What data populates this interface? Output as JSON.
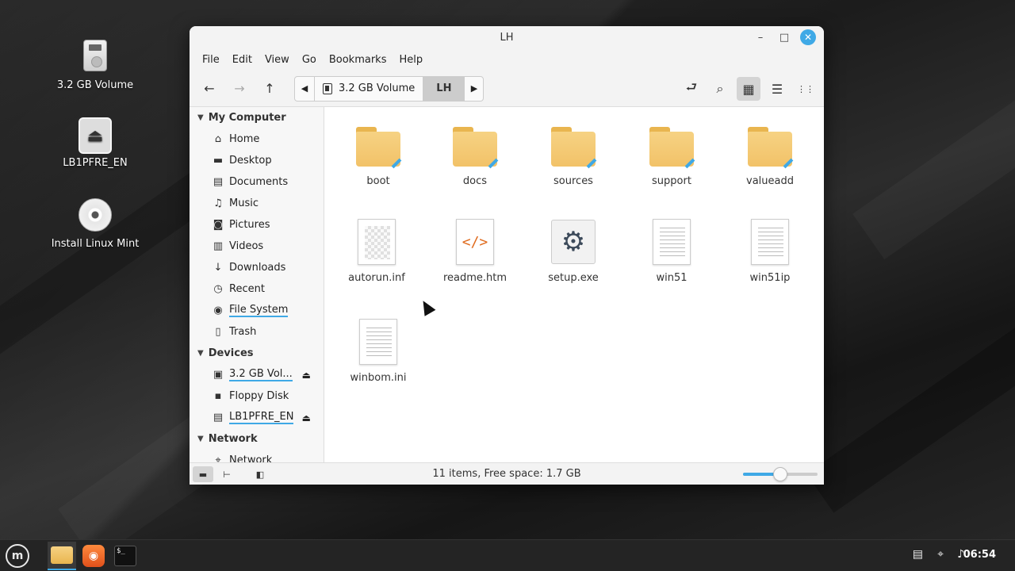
{
  "desktop": {
    "icons": [
      {
        "label": "3.2 GB Volume",
        "icon": "drive-icon"
      },
      {
        "label": "LB1PFRE_EN",
        "icon": "eject-icon"
      },
      {
        "label": "Install Linux Mint",
        "icon": "disc-icon"
      }
    ]
  },
  "window": {
    "title": "LH",
    "controls": {
      "minimize": "–",
      "maximize": "□",
      "close": "✕"
    }
  },
  "menu": [
    "File",
    "Edit",
    "View",
    "Go",
    "Bookmarks",
    "Help"
  ],
  "toolbar": {
    "back": "←",
    "forward": "→",
    "up": "↑",
    "path": [
      {
        "label": "3.2 GB Volume",
        "active": false
      },
      {
        "label": "LH",
        "active": true
      }
    ],
    "toggle_location": "⮐",
    "search": "⌕",
    "view_icons": "▦",
    "view_list": "☰",
    "view_compact": "⋮⋮"
  },
  "sidebar": {
    "sections": [
      {
        "title": "My Computer",
        "items": [
          {
            "label": "Home",
            "icon": "home-icon",
            "glyph": "⌂"
          },
          {
            "label": "Desktop",
            "icon": "desktop-icon",
            "glyph": "▬"
          },
          {
            "label": "Documents",
            "icon": "documents-icon",
            "glyph": "▤"
          },
          {
            "label": "Music",
            "icon": "music-icon",
            "glyph": "♫"
          },
          {
            "label": "Pictures",
            "icon": "camera-icon",
            "glyph": "◙"
          },
          {
            "label": "Videos",
            "icon": "film-icon",
            "glyph": "▥"
          },
          {
            "label": "Downloads",
            "icon": "download-icon",
            "glyph": "↓"
          },
          {
            "label": "Recent",
            "icon": "clock-icon",
            "glyph": "◷"
          },
          {
            "label": "File System",
            "icon": "filesystem-icon",
            "glyph": "◉"
          },
          {
            "label": "Trash",
            "icon": "trash-icon",
            "glyph": "🗑"
          }
        ]
      },
      {
        "title": "Devices",
        "items": [
          {
            "label": "3.2 GB Vol...",
            "icon": "drive-icon",
            "glyph": "▣",
            "eject": "⏏"
          },
          {
            "label": "Floppy Disk",
            "icon": "floppy-icon",
            "glyph": "▪"
          },
          {
            "label": "LB1PFRE_EN",
            "icon": "optical-drive-icon",
            "glyph": "▤",
            "eject": "⏏"
          }
        ]
      },
      {
        "title": "Network",
        "items": [
          {
            "label": "Network",
            "icon": "network-icon",
            "glyph": "⌖"
          }
        ]
      }
    ]
  },
  "files": [
    {
      "name": "boot",
      "type": "folder"
    },
    {
      "name": "docs",
      "type": "folder"
    },
    {
      "name": "sources",
      "type": "folder"
    },
    {
      "name": "support",
      "type": "folder"
    },
    {
      "name": "valueadd",
      "type": "folder"
    },
    {
      "name": "autorun.inf",
      "type": "config"
    },
    {
      "name": "readme.htm",
      "type": "html"
    },
    {
      "name": "setup.exe",
      "type": "exe"
    },
    {
      "name": "win51",
      "type": "text"
    },
    {
      "name": "win51ip",
      "type": "text"
    },
    {
      "name": "winbom.ini",
      "type": "text"
    }
  ],
  "statusbar": {
    "text": "11 items, Free space: 1.7 GB",
    "zoom_fraction": 0.5
  },
  "taskbar": {
    "clock": "06:54"
  },
  "colors": {
    "accent": "#3fa9e6",
    "folder": "#f2c268"
  }
}
